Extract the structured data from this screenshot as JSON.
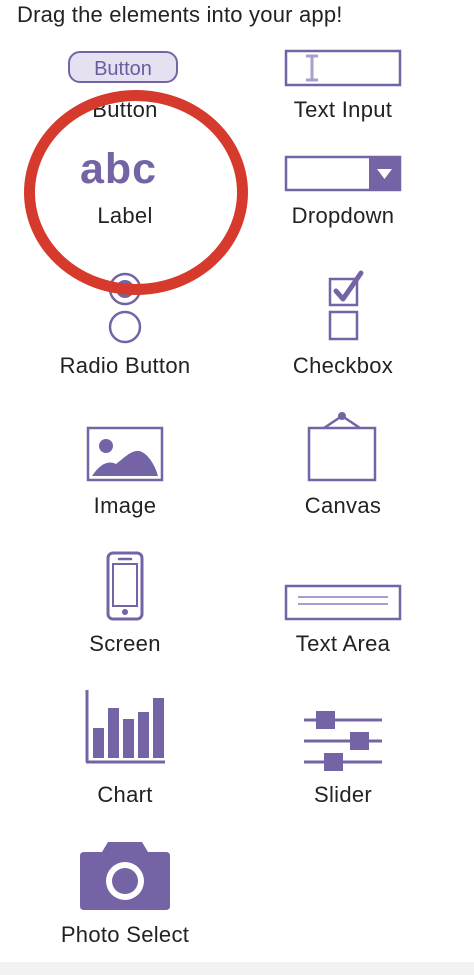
{
  "header": {
    "instructions": "Drag the elements into your app!"
  },
  "palette": {
    "button": {
      "icon_text": "Button",
      "label": "Button"
    },
    "text_input": {
      "label": "Text Input"
    },
    "label": {
      "icon_text": "abc",
      "label": "Label"
    },
    "dropdown": {
      "label": "Dropdown"
    },
    "radio_button": {
      "label": "Radio Button"
    },
    "checkbox": {
      "label": "Checkbox"
    },
    "image": {
      "label": "Image"
    },
    "canvas": {
      "label": "Canvas"
    },
    "screen": {
      "label": "Screen"
    },
    "text_area": {
      "label": "Text Area"
    },
    "chart": {
      "label": "Chart"
    },
    "slider": {
      "label": "Slider"
    },
    "photo_select": {
      "label": "Photo Select"
    }
  },
  "colors": {
    "icon_purple": "#7464a6",
    "icon_fill_light": "#e6e1f1",
    "highlight_red": "#d63a2c",
    "text": "#222222"
  },
  "icons": {
    "text_input": "text-input-icon",
    "dropdown": "dropdown-icon",
    "radio_button": "radio-button-icon",
    "checkbox": "checkbox-icon",
    "image": "image-icon",
    "canvas": "canvas-icon",
    "screen": "screen-icon",
    "text_area": "text-area-icon",
    "chart": "chart-icon",
    "slider": "slider-icon",
    "photo_select": "camera-icon"
  }
}
